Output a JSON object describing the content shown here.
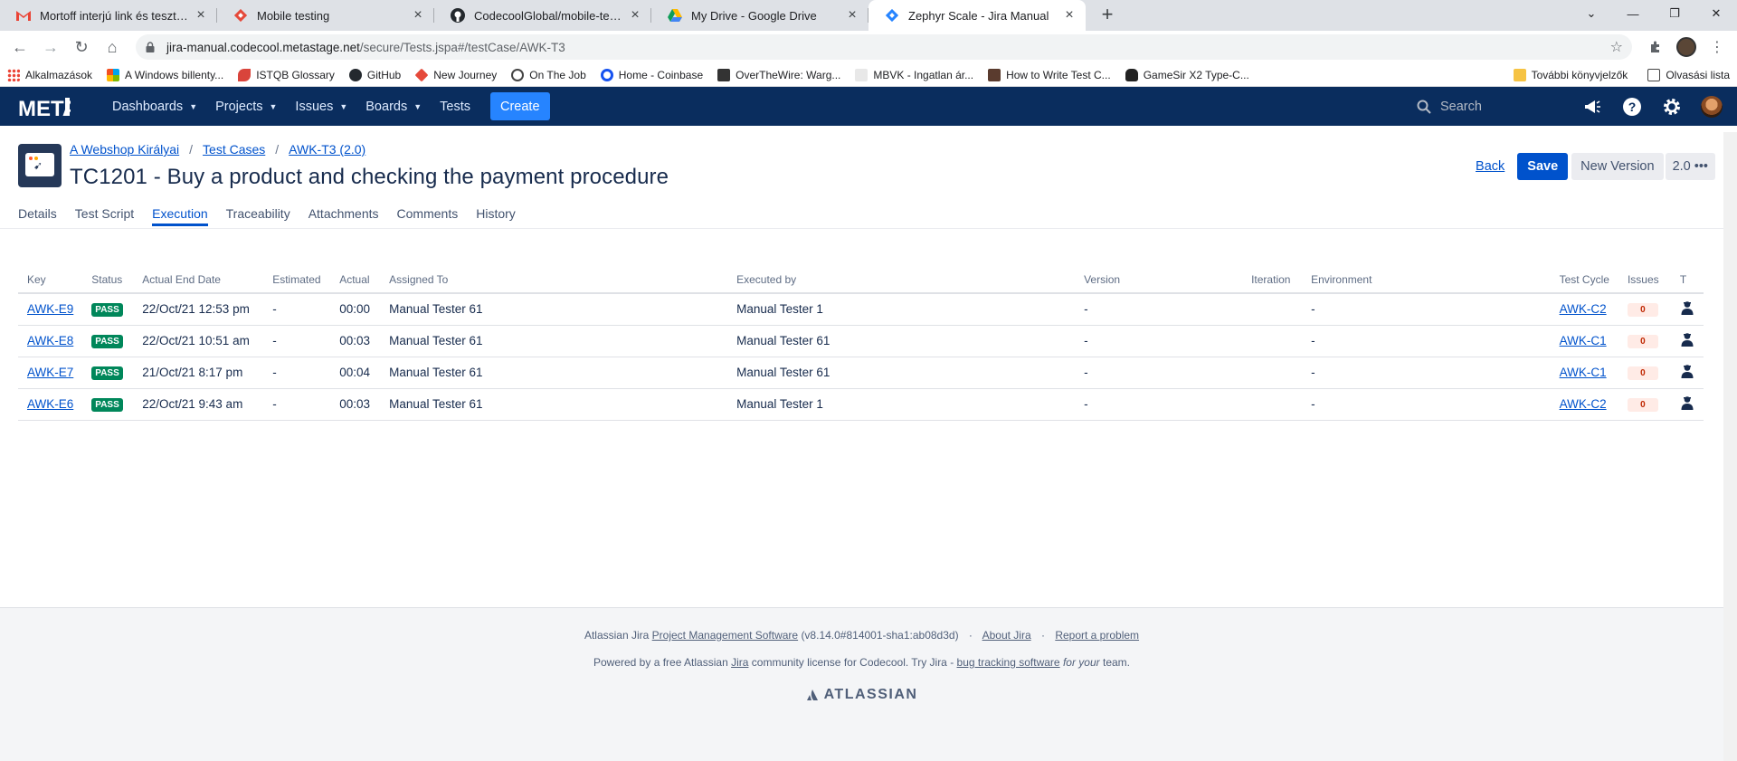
{
  "browser": {
    "tabs": [
      {
        "title": "Mortoff interjú link és tesztek - c",
        "icon": "gmail-icon"
      },
      {
        "title": "Mobile testing",
        "icon": "jira-red-icon"
      },
      {
        "title": "CodecoolGlobal/mobile-testing-",
        "icon": "github-icon"
      },
      {
        "title": "My Drive - Google Drive",
        "icon": "google-drive-icon"
      },
      {
        "title": "Zephyr Scale - Jira Manual",
        "icon": "zephyr-icon"
      }
    ],
    "url_host": "jira-manual.codecool.metastage.net",
    "url_path": "/secure/Tests.jspa#/testCase/AWK-T3",
    "bookmarks": [
      "Alkalmazások",
      "A Windows billenty...",
      "ISTQB Glossary",
      "GitHub",
      "New Journey",
      "On The Job",
      "Home - Coinbase",
      "OverTheWire: Warg...",
      "MBVK - Ingatlan ár...",
      "How to Write Test C...",
      "GameSir X2 Type-C..."
    ],
    "bookmarks_right": [
      "További könyvjelzők",
      "Olvasási lista"
    ]
  },
  "header": {
    "logo": "META",
    "nav": [
      "Dashboards",
      "Projects",
      "Issues",
      "Boards",
      "Tests"
    ],
    "create_label": "Create",
    "search_placeholder": "Search"
  },
  "page": {
    "breadcrumbs": [
      "A Webshop Királyai",
      "Test Cases",
      "AWK-T3 (2.0)"
    ],
    "title": "TC1201 - Buy a product and checking the payment procedure",
    "back_label": "Back",
    "save_label": "Save",
    "new_version_label": "New Version",
    "version": "2.0",
    "tabs": [
      "Details",
      "Test Script",
      "Execution",
      "Traceability",
      "Attachments",
      "Comments",
      "History"
    ],
    "active_tab": "Execution"
  },
  "table": {
    "columns": [
      "Key",
      "Status",
      "Actual End Date",
      "Estimated",
      "Actual",
      "Assigned To",
      "Executed by",
      "Version",
      "Iteration",
      "Environment",
      "Test Cycle",
      "Issues",
      "T"
    ],
    "rows": [
      {
        "key": "AWK-E9",
        "status": "PASS",
        "end_date": "22/Oct/21 12:53 pm",
        "estimated": "-",
        "actual": "00:00",
        "assigned_to": "Manual Tester 61",
        "executed_by": "Manual Tester 1",
        "version": "-",
        "iteration": "",
        "environment": "-",
        "test_cycle": "AWK-C2",
        "issues": "0"
      },
      {
        "key": "AWK-E8",
        "status": "PASS",
        "end_date": "22/Oct/21 10:51 am",
        "estimated": "-",
        "actual": "00:03",
        "assigned_to": "Manual Tester 61",
        "executed_by": "Manual Tester 61",
        "version": "-",
        "iteration": "",
        "environment": "-",
        "test_cycle": "AWK-C1",
        "issues": "0"
      },
      {
        "key": "AWK-E7",
        "status": "PASS",
        "end_date": "21/Oct/21 8:17 pm",
        "estimated": "-",
        "actual": "00:04",
        "assigned_to": "Manual Tester 61",
        "executed_by": "Manual Tester 61",
        "version": "-",
        "iteration": "",
        "environment": "-",
        "test_cycle": "AWK-C1",
        "issues": "0"
      },
      {
        "key": "AWK-E6",
        "status": "PASS",
        "end_date": "22/Oct/21 9:43 am",
        "estimated": "-",
        "actual": "00:03",
        "assigned_to": "Manual Tester 61",
        "executed_by": "Manual Tester 1",
        "version": "-",
        "iteration": "",
        "environment": "-",
        "test_cycle": "AWK-C2",
        "issues": "0"
      }
    ]
  },
  "footer": {
    "line1_prefix": "Atlassian Jira",
    "line1_link": "Project Management Software",
    "line1_version": "(v8.14.0#814001-sha1:ab08d3d)",
    "about": "About Jira",
    "report": "Report a problem",
    "line2_a": "Powered by a free Atlassian",
    "line2_jira": "Jira",
    "line2_b": "community license for Codecool. Try Jira -",
    "line2_link": "bug tracking software",
    "line2_c": "for",
    "line2_your": "your",
    "line2_d": "team.",
    "atlassian": "ATLASSIAN"
  },
  "colors": {
    "header_bg": "#0a2d5e",
    "header_accent": "#e07a2c",
    "primary": "#0052cc",
    "pass": "#00875a"
  }
}
